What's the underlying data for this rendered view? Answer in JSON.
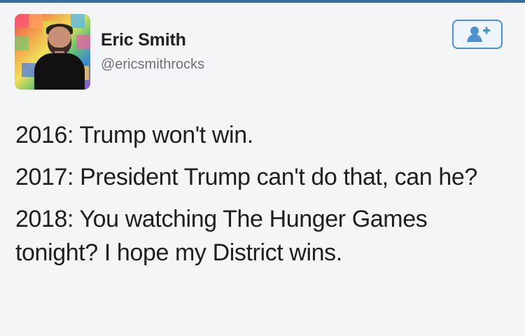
{
  "user": {
    "name": "Eric Smith",
    "handle": "@ericsmithrocks",
    "avatar_icon": "user-avatar-photo"
  },
  "follow_button": {
    "icon": "add-user-icon",
    "accent_color": "#4b91cf"
  },
  "tweet": {
    "lines": [
      "2016: Trump won't win.",
      "2017: President Trump can't do that, can he?",
      "2018: You watching The Hunger Games tonight? I hope my District wins."
    ]
  }
}
